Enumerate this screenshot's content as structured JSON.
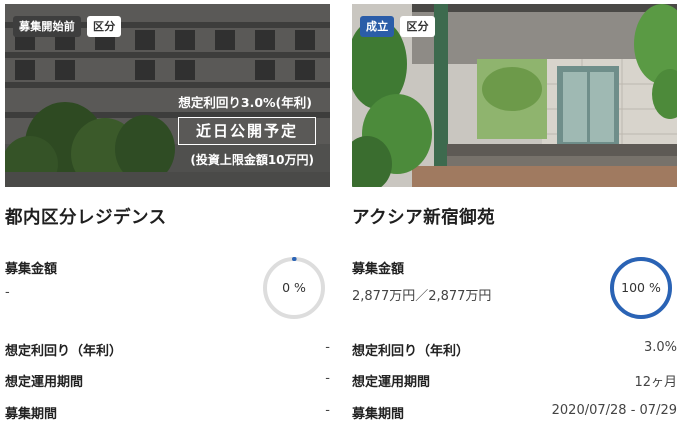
{
  "cards": [
    {
      "status_badge": "募集開始前",
      "type_badge": "区分",
      "overlay": {
        "yield_text": "想定利回り3.0%(年利)",
        "announce": "近日公開予定",
        "note": "(投資上限金額10万円)"
      },
      "title": "都内区分レジデンス",
      "amount_label": "募集金額",
      "amount_value": "-",
      "progress": 0,
      "progress_label": "0 %",
      "yield_label": "想定利回り（年利）",
      "yield_value": "-",
      "term_label": "想定運用期間",
      "term_value": "-",
      "period_label": "募集期間",
      "period_value": "-",
      "status_color": "#3e3e3e"
    },
    {
      "status_badge": "成立",
      "type_badge": "区分",
      "title": "アクシア新宿御苑",
      "amount_label": "募集金額",
      "amount_value": "2,877万円／2,877万円",
      "progress": 1.0,
      "progress_label": "100 %",
      "yield_label": "想定利回り（年利）",
      "yield_value": "3.0%",
      "term_label": "想定運用期間",
      "term_value": "12ヶ月",
      "period_label": "募集期間",
      "period_value": "2020/07/28 - 07/29",
      "status_color": "#2b5da8"
    }
  ],
  "colors": {
    "progress_fill": "#2a63b5",
    "progress_track": "#dddddd"
  }
}
